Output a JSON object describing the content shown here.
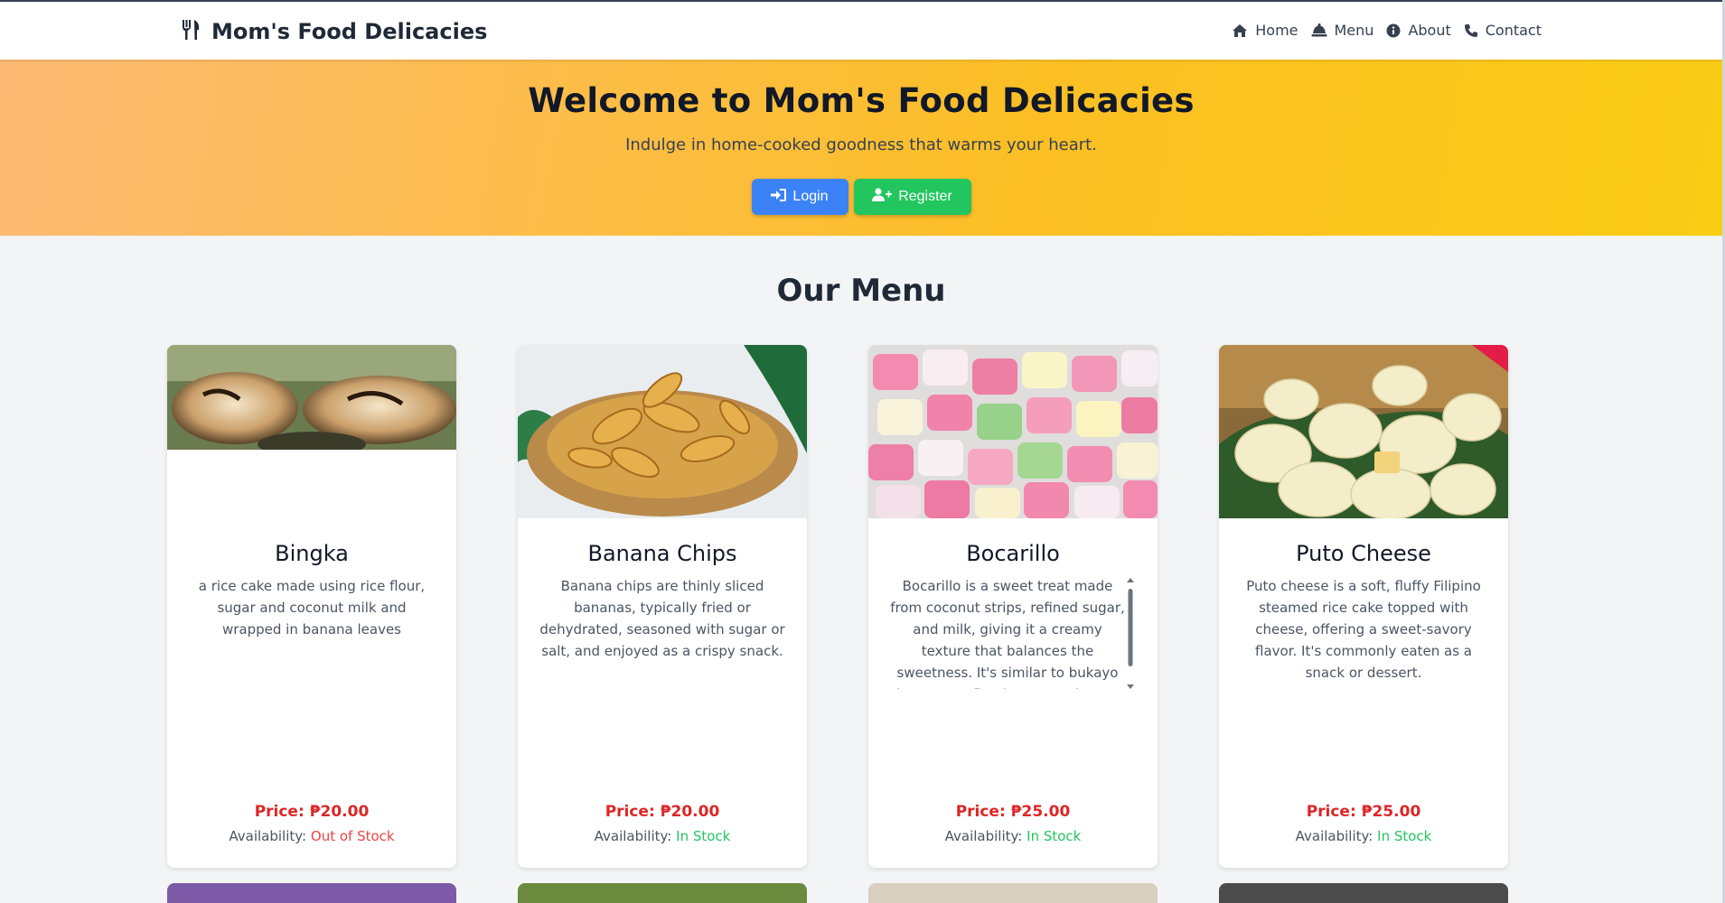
{
  "brand": {
    "name": "Mom's Food Delicacies",
    "icon": "utensils-icon"
  },
  "nav": [
    {
      "label": "Home",
      "icon": "home-icon"
    },
    {
      "label": "Menu",
      "icon": "bell-icon"
    },
    {
      "label": "About",
      "icon": "info-icon"
    },
    {
      "label": "Contact",
      "icon": "phone-icon"
    }
  ],
  "hero": {
    "title": "Welcome to Mom's Food Delicacies",
    "subtitle": "Indulge in home-cooked goodness that warms your heart.",
    "login_label": "Login",
    "register_label": "Register"
  },
  "menu": {
    "title": "Our Menu",
    "price_prefix": "Price:",
    "availability_prefix": "Availability:",
    "items": [
      {
        "name": "Bingka",
        "description": "a rice cake made using rice flour, sugar and coconut milk and wrapped in banana leaves",
        "price": "₱20.00",
        "availability": "Out of Stock"
      },
      {
        "name": "Banana Chips",
        "description": "Banana chips are thinly sliced bananas, typically fried or dehydrated, seasoned with sugar or salt, and enjoyed as a crispy snack.",
        "price": "₱20.00",
        "availability": "In Stock"
      },
      {
        "name": "Bocarillo",
        "description": "Bocarillo is a sweet treat made from coconut strips, refined sugar, and milk, giving it a creamy texture that balances the sweetness. It's similar to bukayo but uses refined sugar and extra flavor.",
        "price": "₱25.00",
        "availability": "In Stock"
      },
      {
        "name": "Puto Cheese",
        "description": "Puto cheese is a soft, fluffy Filipino steamed rice cake topped with cheese, offering a sweet-savory flavor. It's commonly eaten as a snack or dessert.",
        "price": "₱25.00",
        "availability": "In Stock"
      }
    ]
  },
  "colors": {
    "price": "#dc2626",
    "in_stock": "#22c55e",
    "out_of_stock": "#ef4444",
    "login": "#3b82f6",
    "register": "#22c55e"
  }
}
